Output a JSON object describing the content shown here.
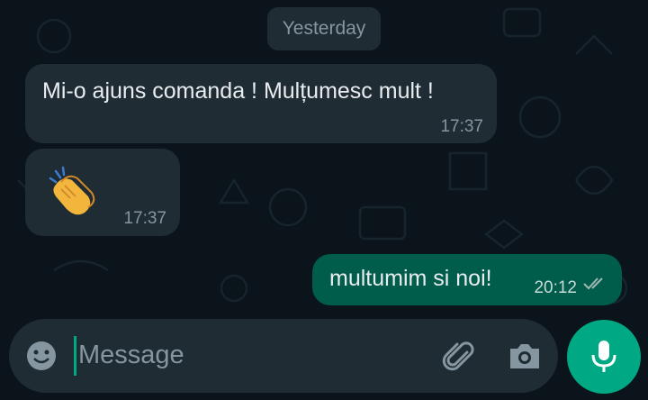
{
  "date_separator": "Yesterday",
  "messages": [
    {
      "direction": "in",
      "text": "Mi-o ajuns comanda ! Mulțumesc mult !",
      "time": "17:37"
    },
    {
      "direction": "in",
      "emoji": "clapping-hands",
      "time": "17:37"
    },
    {
      "direction": "out",
      "text": "multumim si noi!",
      "time": "20:12",
      "status": "read"
    }
  ],
  "composer": {
    "placeholder": "Message"
  },
  "icons": {
    "emoji": "emoji-icon",
    "attach": "paperclip-icon",
    "camera": "camera-icon",
    "mic": "microphone-icon",
    "read_receipt": "double-check-icon",
    "message_emoji": "clapping-hands-icon"
  },
  "colors": {
    "background": "#0b141a",
    "incoming_bubble": "#1f2c33",
    "outgoing_bubble": "#005c4b",
    "accent": "#00a884",
    "secondary_text": "#8696a0"
  }
}
